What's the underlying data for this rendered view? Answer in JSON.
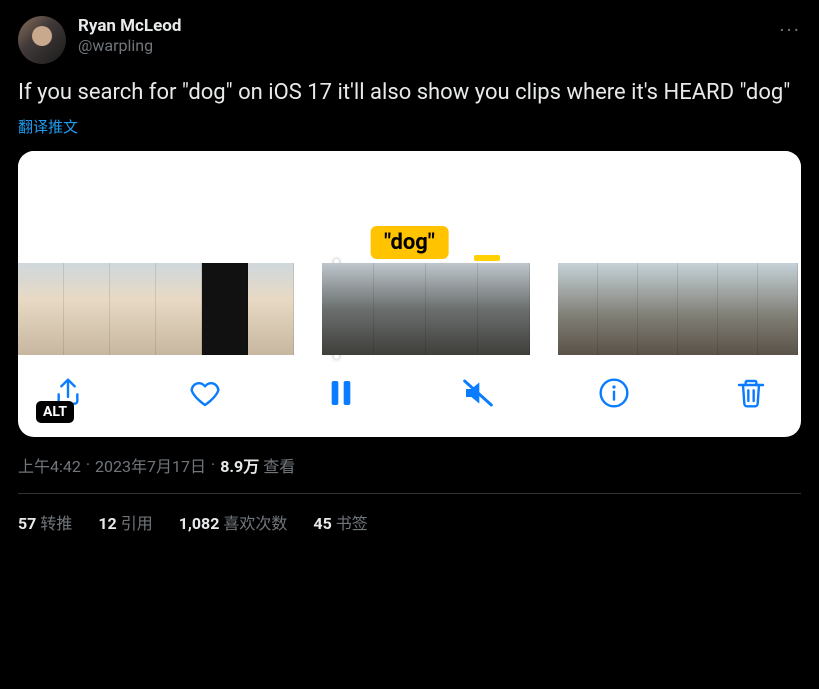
{
  "author": {
    "display_name": "Ryan McLeod",
    "handle": "@warpling"
  },
  "body": "If you search for \"dog\" on iOS 17 it'll also show you clips where it's HEARD \"dog\"",
  "translate_label": "翻译推文",
  "media": {
    "badge_text": "\"dog\"",
    "alt_label": "ALT",
    "toolbar_icons": {
      "share": "share-icon",
      "like": "heart-icon",
      "pause": "pause-icon",
      "mute": "volume-muted-icon",
      "info": "info-icon",
      "delete": "trash-icon"
    }
  },
  "meta": {
    "time": "上午4:42",
    "date": "2023年7月17日",
    "views_number": "8.9万",
    "views_label": "查看"
  },
  "stats": {
    "retweets_num": "57",
    "retweets_label": "转推",
    "quotes_num": "12",
    "quotes_label": "引用",
    "likes_num": "1,082",
    "likes_label": "喜欢次数",
    "bookmarks_num": "45",
    "bookmarks_label": "书签"
  }
}
